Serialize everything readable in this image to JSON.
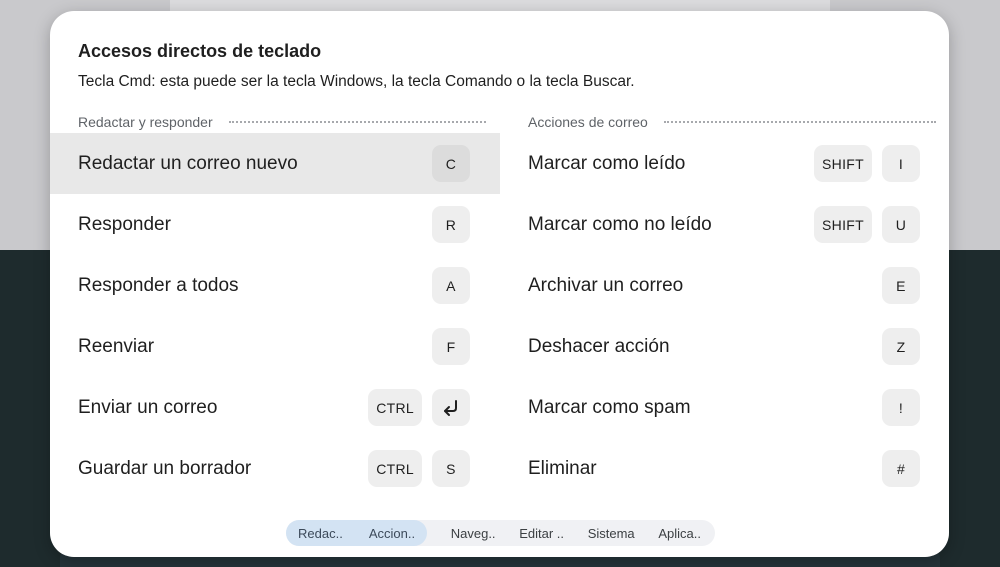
{
  "dialog": {
    "title": "Accesos directos de teclado",
    "subtitle": "Tecla Cmd: esta puede ser la tecla Windows, la tecla Comando o la tecla Buscar."
  },
  "left": {
    "header": "Redactar y responder",
    "rows": [
      {
        "label": "Redactar un correo nuevo",
        "keys": [
          "C"
        ]
      },
      {
        "label": "Responder",
        "keys": [
          "R"
        ]
      },
      {
        "label": "Responder a todos",
        "keys": [
          "A"
        ]
      },
      {
        "label": "Reenviar",
        "keys": [
          "F"
        ]
      },
      {
        "label": "Enviar un correo",
        "keys": [
          "CTRL"
        ],
        "extra_key_icon": "enter-arrow-icon"
      },
      {
        "label": "Guardar un borrador",
        "keys": [
          "CTRL",
          "S"
        ]
      }
    ]
  },
  "right": {
    "header": "Acciones de correo",
    "rows": [
      {
        "label": "Marcar como leído",
        "keys": [
          "SHIFT",
          "I"
        ]
      },
      {
        "label": "Marcar como no leído",
        "keys": [
          "SHIFT",
          "U"
        ]
      },
      {
        "label": "Archivar un correo",
        "keys": [
          "E"
        ]
      },
      {
        "label": "Deshacer acción",
        "keys": [
          "Z"
        ]
      },
      {
        "label": "Marcar como spam",
        "keys": [
          "!"
        ]
      },
      {
        "label": "Eliminar",
        "keys": [
          "#"
        ]
      }
    ]
  },
  "tabs": [
    "Redac..",
    "Accion..",
    "Naveg..",
    "Editar ..",
    "Sistema",
    "Aplica.."
  ],
  "colors": {
    "selected_row": "#e8e8e8",
    "key_bg": "#eeeeee",
    "active_tab_bg": "#d3e3f3"
  }
}
